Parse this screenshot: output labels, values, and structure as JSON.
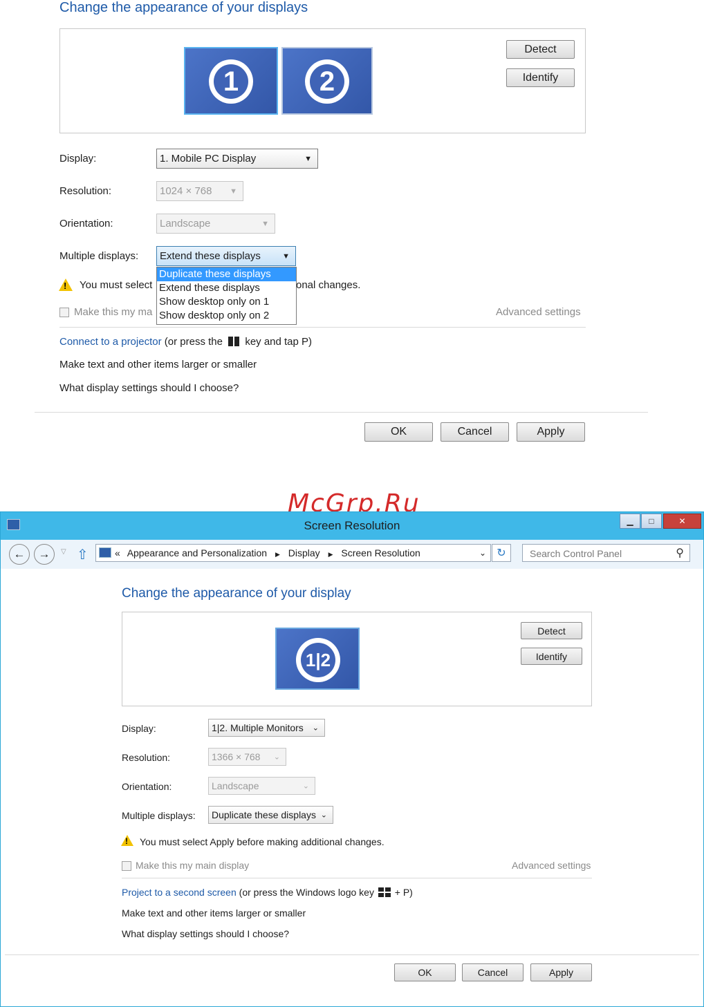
{
  "top": {
    "heading": "Change the appearance of your displays",
    "monitor1": "1",
    "monitor2": "2",
    "detect": "Detect",
    "identify": "Identify",
    "display_label": "Display:",
    "display_value": "1. Mobile PC Display",
    "resolution_label": "Resolution:",
    "resolution_value": "1024 × 768",
    "orientation_label": "Orientation:",
    "orientation_value": "Landscape",
    "multiple_label": "Multiple displays:",
    "multiple_value": "Extend these displays",
    "dropdown_options": [
      "Duplicate these displays",
      "Extend these displays",
      "Show desktop only on 1",
      "Show desktop only on 2"
    ],
    "warning_pre": "You must select",
    "warning_post": "onal changes.",
    "checkbox_text": "Make this my ma",
    "advanced": "Advanced settings",
    "projector_link": "Connect to a projector",
    "projector_text_a": "(or press the",
    "projector_text_b": "key and tap P)",
    "text_link": "Make text and other items larger or smaller",
    "settings_link": "What display settings should I choose?",
    "ok": "OK",
    "cancel": "Cancel",
    "apply": "Apply"
  },
  "watermark": "McGrp.Ru",
  "window": {
    "title": "Screen Resolution",
    "breadcrumb_prefix": "«",
    "breadcrumb": [
      "Appearance and Personalization",
      "Display",
      "Screen Resolution"
    ],
    "search_placeholder": "Search Control Panel",
    "heading": "Change the appearance of your display",
    "monitor_label": "1|2",
    "detect": "Detect",
    "identify": "Identify",
    "display_label": "Display:",
    "display_value": "1|2. Multiple Monitors",
    "resolution_label": "Resolution:",
    "resolution_value": "1366 × 768",
    "orientation_label": "Orientation:",
    "orientation_value": "Landscape",
    "multiple_label": "Multiple displays:",
    "multiple_value": "Duplicate these displays",
    "warning": "You must select Apply before making additional changes.",
    "checkbox_text": "Make this my main display",
    "advanced": "Advanced settings",
    "project_link": "Project to a second screen",
    "project_text_a": "(or press the Windows logo key",
    "project_text_b": "+ P)",
    "text_link": "Make text and other items larger or smaller",
    "settings_link": "What display settings should I choose?",
    "ok": "OK",
    "cancel": "Cancel",
    "apply": "Apply"
  }
}
